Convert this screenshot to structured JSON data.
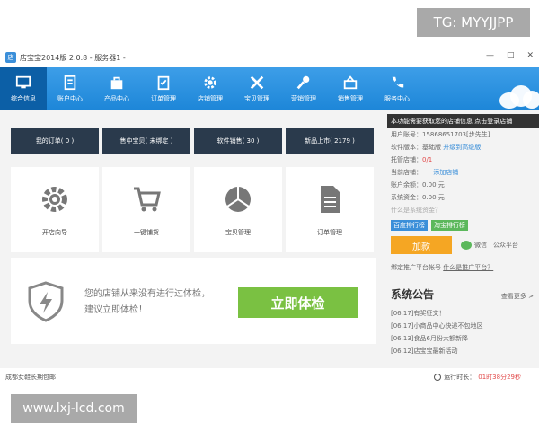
{
  "watermarks": {
    "top": "TG: MYYJJPP",
    "bottom": "www.lxj-lcd.com"
  },
  "window": {
    "title": "店宝宝2014版 2.0.8 - 服务器1 -",
    "logo": "店",
    "minimize": "—",
    "maximize": "□",
    "close": "✕"
  },
  "toolbar": {
    "tabs": [
      {
        "label": "综合信息",
        "icon": "monitor-icon",
        "active": true
      },
      {
        "label": "账户中心",
        "icon": "account-icon"
      },
      {
        "label": "产品中心",
        "icon": "bag-icon"
      },
      {
        "label": "订单管理",
        "icon": "order-icon"
      },
      {
        "label": "店铺管理",
        "icon": "gear-icon"
      },
      {
        "label": "宝贝管理",
        "icon": "tools-icon"
      },
      {
        "label": "营销管理",
        "icon": "microphone-icon"
      },
      {
        "label": "销售管理",
        "icon": "basket-icon"
      },
      {
        "label": "服务中心",
        "icon": "phone-icon"
      }
    ]
  },
  "notice_bar": "本功能需要获取您的店铺信息 点击登录店铺",
  "stats": [
    {
      "label": "我的订单( 0 )"
    },
    {
      "label": "售中宝贝( 未绑定 )"
    },
    {
      "label": "软件销售( 30 )"
    },
    {
      "label": "新品上市( 2179 )"
    }
  ],
  "cards": [
    {
      "label": "开店向导",
      "icon": "gear-icon"
    },
    {
      "label": "一键铺货",
      "icon": "cart-icon"
    },
    {
      "label": "宝贝管理",
      "icon": "box-icon"
    },
    {
      "label": "订单管理",
      "icon": "document-icon"
    }
  ],
  "checkup": {
    "line1": "您的店铺从来没有进行过体检，",
    "line2": "建议立即体检！",
    "button": "立即体检"
  },
  "sidebar": {
    "user_label": "用户账号：",
    "user_value": "15868651703[步先生]",
    "version_label": "软件版本：",
    "version_value": "基础版",
    "upgrade": "升级到高级版",
    "managed_label": "托管店铺：",
    "managed_value": "0/1",
    "current_label": "当前店铺：",
    "add_store": "添加店铺",
    "balance_label": "账户余额：",
    "balance_value": "0.00 元",
    "system_label": "系统资金：",
    "system_value": "0.00 元",
    "what_is": "什么是系统资金？",
    "baidu_rank": "百度排行榜",
    "taobao_rank": "淘宝排行榜",
    "recharge": "加款",
    "wechat": "微信｜公众平台",
    "bind_label": "绑定推广平台帐号",
    "bind_link": "什么是推广平台？"
  },
  "announcements": {
    "title": "系统公告",
    "more": "查看更多 >",
    "items": [
      "[06.17]有奖征文！",
      "[06.17]小商品中心快递不包地区",
      "[06.13]食品6月份大额新降",
      "[06.12]店宝宝最新活动"
    ]
  },
  "status": {
    "left": "成都女鞋长期包邮",
    "runtime_label": "运行时长：",
    "runtime_value": "01时38分29秒"
  },
  "colors": {
    "toolbar": "#1d86d8",
    "active_tab": "#0c5fa6",
    "stat_bg": "#2a3a4c",
    "green": "#7ac142",
    "orange": "#f5a623"
  }
}
